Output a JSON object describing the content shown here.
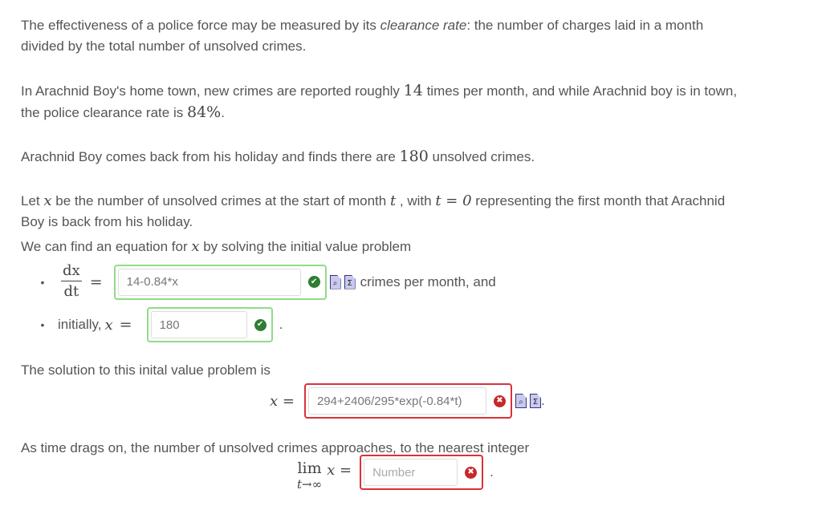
{
  "intro": {
    "before_italic": "The effectiveness of a police force may be measured by its ",
    "italic_term": "clearance rate",
    "after_italic": ": the number of charges laid in a month",
    "line2": "divided by the total number of unsolved crimes."
  },
  "context": {
    "p2_a": "In Arachnid Boy's home town, new crimes are reported roughly ",
    "crimes_per_month": "14",
    "p2_b": " times per month, and while Arachnid boy is in town,",
    "p2_c": "the police clearance rate is ",
    "clearance_rate": "84%",
    "p2_d": ".",
    "p3_a": "Arachnid Boy comes back from his holiday and finds there are ",
    "unsolved_crimes": "180",
    "p3_b": " unsolved crimes."
  },
  "setup": {
    "p4_a": "Let ",
    "var_x": "x",
    "p4_b": " be the number of unsolved crimes at the start of month ",
    "var_t": "t",
    "p4_c": " , with ",
    "t_eq": "t = 0",
    "p4_d": " representing the first month that Arachnid",
    "p4_line2": "Boy is back from his holiday.",
    "p5_a": "We can find an equation for ",
    "p5_b": " by solving the initial value problem"
  },
  "ivp": {
    "bullet_glyph": "•",
    "deriv_num": "dx",
    "deriv_den": "dt",
    "equals": "=",
    "dxdt_answer": "14-0.84*x",
    "dxdt_status": "correct",
    "dxdt_suffix": "crimes per month, and",
    "initial_label": "initially, ",
    "initial_answer": "180",
    "initial_status": "correct",
    "initial_suffix": "."
  },
  "solution": {
    "intro": "The solution to this inital value problem is",
    "lhs": "x =",
    "answer": "294+2406/295*exp(-0.84*t)",
    "status": "incorrect",
    "suffix": "."
  },
  "limit": {
    "intro": "As time drags on, the number of unsolved crimes approaches, to the nearest integer",
    "lim_top": "lim",
    "lim_bottom": "t→∞",
    "lhs": "x =",
    "answer": "",
    "placeholder": "Number",
    "status": "incorrect",
    "suffix": "."
  },
  "icons": {
    "correct": "check-circle-icon",
    "incorrect": "x-circle-icon",
    "preview": "preview-document-icon",
    "syntax": "sigma-document-icon",
    "correct_glyph": "✔",
    "incorrect_glyph": "✖",
    "preview_glyph": "⌕",
    "syntax_glyph": "Σ"
  },
  "colors": {
    "correct_border": "#8fdc87",
    "incorrect_border": "#d9323a",
    "correct_icon": "#2e7d32",
    "incorrect_icon": "#c62828"
  }
}
